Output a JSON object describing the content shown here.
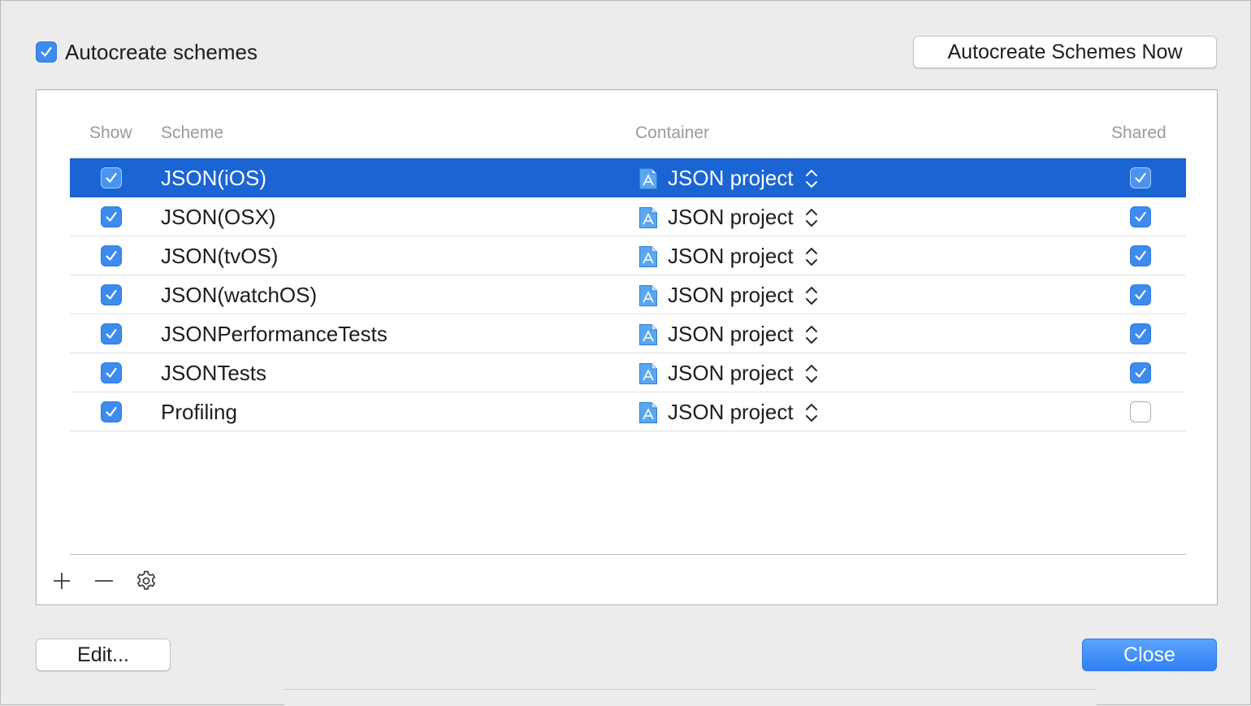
{
  "autocreate": {
    "label": "Autocreate schemes",
    "checked": true
  },
  "buttons": {
    "autocreate_now": "Autocreate Schemes Now",
    "edit": "Edit...",
    "close": "Close"
  },
  "table": {
    "headers": {
      "show": "Show",
      "scheme": "Scheme",
      "container": "Container",
      "shared": "Shared"
    },
    "rows": [
      {
        "show": true,
        "scheme": "JSON(iOS)",
        "container": "JSON project",
        "shared": true,
        "selected": true
      },
      {
        "show": true,
        "scheme": "JSON(OSX)",
        "container": "JSON project",
        "shared": true,
        "selected": false
      },
      {
        "show": true,
        "scheme": "JSON(tvOS)",
        "container": "JSON project",
        "shared": true,
        "selected": false
      },
      {
        "show": true,
        "scheme": "JSON(watchOS)",
        "container": "JSON project",
        "shared": true,
        "selected": false
      },
      {
        "show": true,
        "scheme": "JSONPerformanceTests",
        "container": "JSON project",
        "shared": true,
        "selected": false
      },
      {
        "show": true,
        "scheme": "JSONTests",
        "container": "JSON project",
        "shared": true,
        "selected": false
      },
      {
        "show": true,
        "scheme": "Profiling",
        "container": "JSON project",
        "shared": false,
        "selected": false
      }
    ]
  },
  "toolbar": {
    "icons": [
      "plus-icon",
      "minus-icon",
      "gear-icon"
    ]
  },
  "colors": {
    "accent": "#3d8bee",
    "selection": "#1a64d4",
    "close_button": "#3b88f8"
  }
}
